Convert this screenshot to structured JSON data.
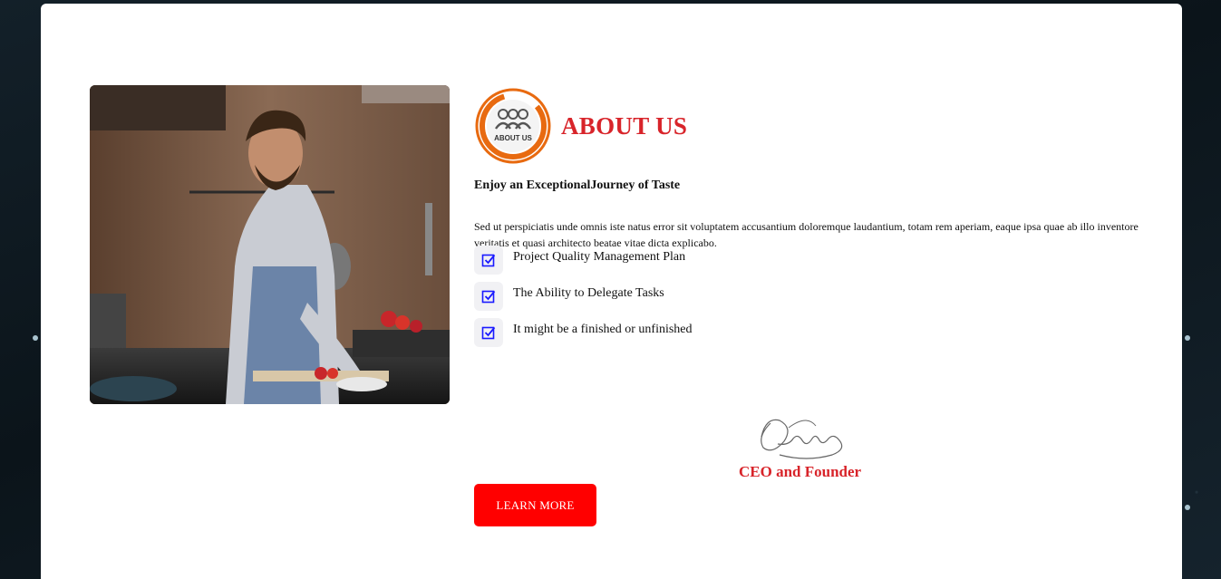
{
  "about": {
    "logo_text": "ABOUT US",
    "title": "ABOUT US",
    "subheading": "Enjoy an ExceptionalJourney of Taste",
    "description": "Sed ut perspiciatis unde omnis iste natus error sit voluptatem accusantium doloremque laudantium, totam rem aperiam, eaque ipsa quae ab illo inventore veritatis et quasi architecto beatae vitae dicta explicabo.",
    "features": [
      {
        "label": "Project Quality Management Plan",
        "icon": "checkbox-icon"
      },
      {
        "label": "The Ability to Delegate Tasks",
        "icon": "checkbox-icon"
      },
      {
        "label": "It might be a finished or unfinished",
        "icon": "checkbox-icon"
      }
    ],
    "signature_role": "CEO and Founder",
    "cta_label": "LEARN MORE"
  },
  "colors": {
    "accent_red": "#d8242a",
    "button_red": "#ff0000",
    "check_blue": "#1a1aff",
    "logo_orange": "#e86a10"
  }
}
